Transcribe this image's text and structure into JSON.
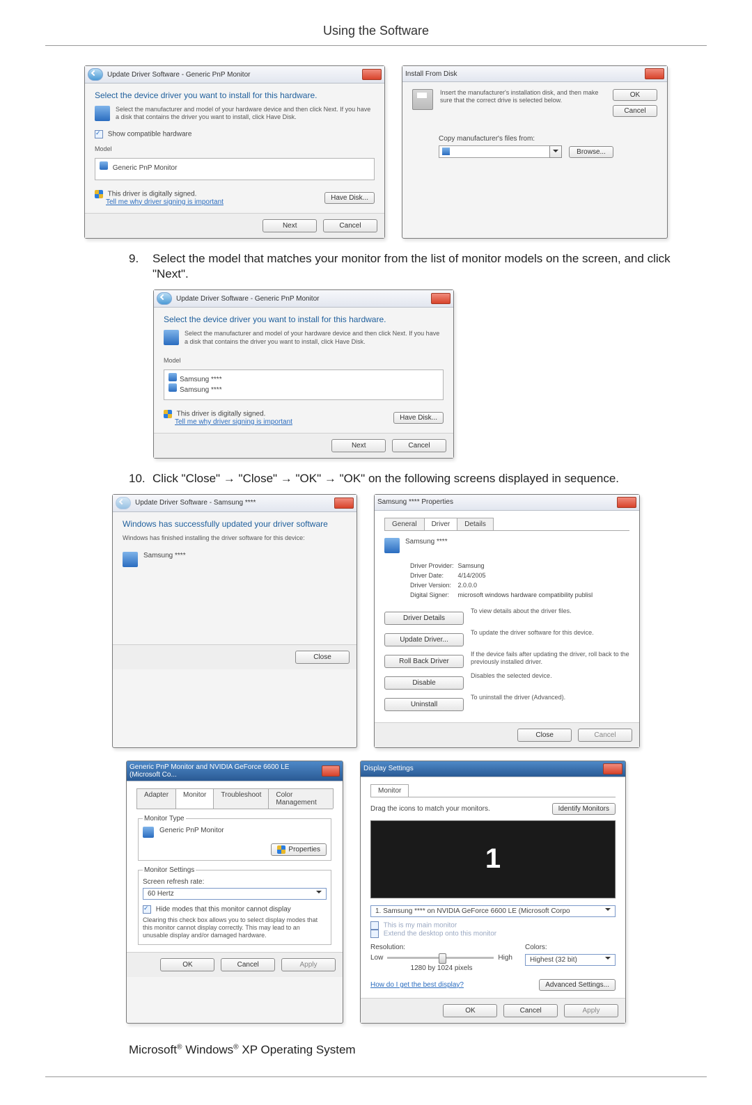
{
  "page_header": "Using the Software",
  "dlg_update1": {
    "crumb": "Update Driver Software - Generic PnP Monitor",
    "heading": "Select the device driver you want to install for this hardware.",
    "hint": "Select the manufacturer and model of your hardware device and then click Next. If you have a disk that contains the driver you want to install, click Have Disk.",
    "show_compatible": "Show compatible hardware",
    "model_label": "Model",
    "model_item": "Generic PnP Monitor",
    "signed": "This driver is digitally signed.",
    "signed_link": "Tell me why driver signing is important",
    "have_disk": "Have Disk...",
    "next": "Next",
    "cancel": "Cancel"
  },
  "dlg_install_from_disk": {
    "title": "Install From Disk",
    "hint": "Insert the manufacturer's installation disk, and then make sure that the correct drive is selected below.",
    "ok": "OK",
    "cancel": "Cancel",
    "copy_label": "Copy manufacturer's files from:",
    "browse": "Browse..."
  },
  "step9_num": "9.",
  "step9_text": "Select the model that matches your monitor from the list of monitor models on the screen, and click \"Next\".",
  "dlg_update2": {
    "crumb": "Update Driver Software - Generic PnP Monitor",
    "heading": "Select the device driver you want to install for this hardware.",
    "hint": "Select the manufacturer and model of your hardware device and then click Next. If you have a disk that contains the driver you want to install, click Have Disk.",
    "model_label": "Model",
    "model_item1": "Samsung ****",
    "model_item2": "Samsung ****",
    "signed": "This driver is digitally signed.",
    "signed_link": "Tell me why driver signing is important",
    "have_disk": "Have Disk...",
    "next": "Next",
    "cancel": "Cancel"
  },
  "step10_num": "10.",
  "step10_text": "Click \"Close\" → \"Close\" → \"OK\" → \"OK\" on the following screens displayed in sequence.",
  "dlg_finished": {
    "crumb": "Update Driver Software - Samsung ****",
    "heading": "Windows has successfully updated your driver software",
    "sub": "Windows has finished installing the driver software for this device:",
    "device": "Samsung ****",
    "close": "Close"
  },
  "dlg_driver_props": {
    "title": "Samsung **** Properties",
    "tab_general": "General",
    "tab_driver": "Driver",
    "tab_details": "Details",
    "device": "Samsung ****",
    "row_provider_k": "Driver Provider:",
    "row_provider_v": "Samsung",
    "row_date_k": "Driver Date:",
    "row_date_v": "4/14/2005",
    "row_version_k": "Driver Version:",
    "row_version_v": "2.0.0.0",
    "row_signer_k": "Digital Signer:",
    "row_signer_v": "microsoft windows hardware compatibility publisl",
    "btn_details": "Driver Details",
    "btn_details_d": "To view details about the driver files.",
    "btn_update": "Update Driver...",
    "btn_update_d": "To update the driver software for this device.",
    "btn_rollback": "Roll Back Driver",
    "btn_rollback_d": "If the device fails after updating the driver, roll back to the previously installed driver.",
    "btn_disable": "Disable",
    "btn_disable_d": "Disables the selected device.",
    "btn_uninstall": "Uninstall",
    "btn_uninstall_d": "To uninstall the driver (Advanced).",
    "close": "Close",
    "cancel": "Cancel"
  },
  "dlg_monitor_props": {
    "title": "Generic PnP Monitor and NVIDIA GeForce 6600 LE (Microsoft Co...",
    "tab_adapter": "Adapter",
    "tab_monitor": "Monitor",
    "tab_trouble": "Troubleshoot",
    "tab_color": "Color Management",
    "monitor_type": "Monitor Type",
    "monitor_name": "Generic PnP Monitor",
    "properties": "Properties",
    "settings": "Monitor Settings",
    "refresh_label": "Screen refresh rate:",
    "refresh_value": "60 Hertz",
    "hide_modes": "Hide modes that this monitor cannot display",
    "hide_modes_desc": "Clearing this check box allows you to select display modes that this monitor cannot display correctly. This may lead to an unusable display and/or damaged hardware.",
    "ok": "OK",
    "cancel": "Cancel",
    "apply": "Apply"
  },
  "dlg_display_settings": {
    "title": "Display Settings",
    "tab_monitor": "Monitor",
    "drag_label": "Drag the icons to match your monitors.",
    "identify": "Identify Monitors",
    "preview_number": "1",
    "monitor_select": "1. Samsung **** on NVIDIA GeForce 6600 LE (Microsoft Corpo",
    "main_monitor": "This is my main monitor",
    "extend": "Extend the desktop onto this monitor",
    "resolution": "Resolution:",
    "res_low": "Low",
    "res_high": "High",
    "res_value": "1280 by 1024 pixels",
    "colors": "Colors:",
    "colors_value": "Highest (32 bit)",
    "best_display": "How do I get the best display?",
    "advanced": "Advanced Settings...",
    "ok": "OK",
    "cancel": "Cancel",
    "apply": "Apply"
  },
  "footer": {
    "ms": "Microsoft",
    "reg": "®",
    "win": " Windows",
    "tail": " XP Operating System"
  }
}
